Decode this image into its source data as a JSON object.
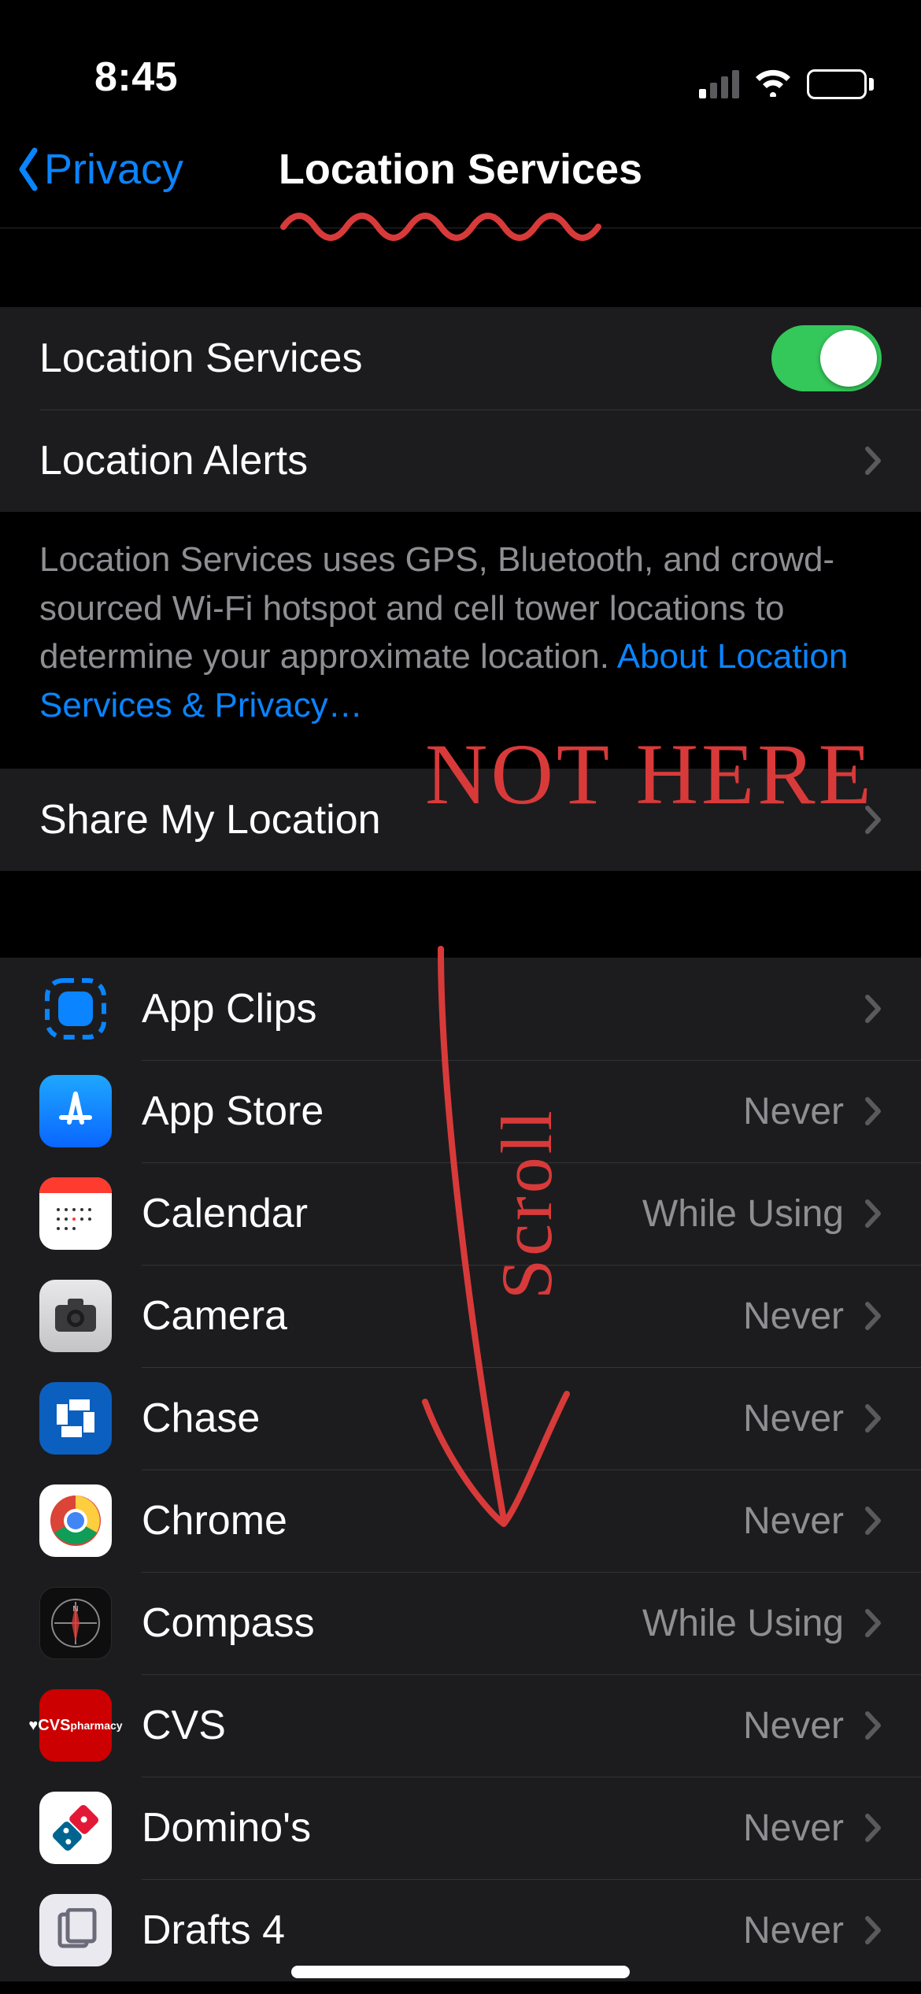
{
  "statusbar": {
    "time": "8:45"
  },
  "nav": {
    "back_label": "Privacy",
    "title": "Location Services"
  },
  "section1": {
    "loc_services_label": "Location Services",
    "loc_services_on": true,
    "loc_alerts_label": "Location Alerts"
  },
  "footer": {
    "text": "Location Services uses GPS, Bluetooth, and crowd-sourced Wi-Fi hotspot and cell tower locations to determine your approximate location. ",
    "link": "About Location Services & Privacy…"
  },
  "section2": {
    "share_label": "Share My Location"
  },
  "apps": [
    {
      "name": "App Clips",
      "status": "",
      "icon": "appclips"
    },
    {
      "name": "App Store",
      "status": "Never",
      "icon": "appstore"
    },
    {
      "name": "Calendar",
      "status": "While Using",
      "icon": "calendar"
    },
    {
      "name": "Camera",
      "status": "Never",
      "icon": "camera"
    },
    {
      "name": "Chase",
      "status": "Never",
      "icon": "chase"
    },
    {
      "name": "Chrome",
      "status": "Never",
      "icon": "chrome"
    },
    {
      "name": "Compass",
      "status": "While Using",
      "icon": "compass"
    },
    {
      "name": "CVS",
      "status": "Never",
      "icon": "cvs"
    },
    {
      "name": "Domino's",
      "status": "Never",
      "icon": "dominos"
    },
    {
      "name": "Drafts 4",
      "status": "Never",
      "icon": "drafts"
    }
  ],
  "annotations": {
    "not_here": "NOT HERE",
    "scroll": "Scroll"
  }
}
